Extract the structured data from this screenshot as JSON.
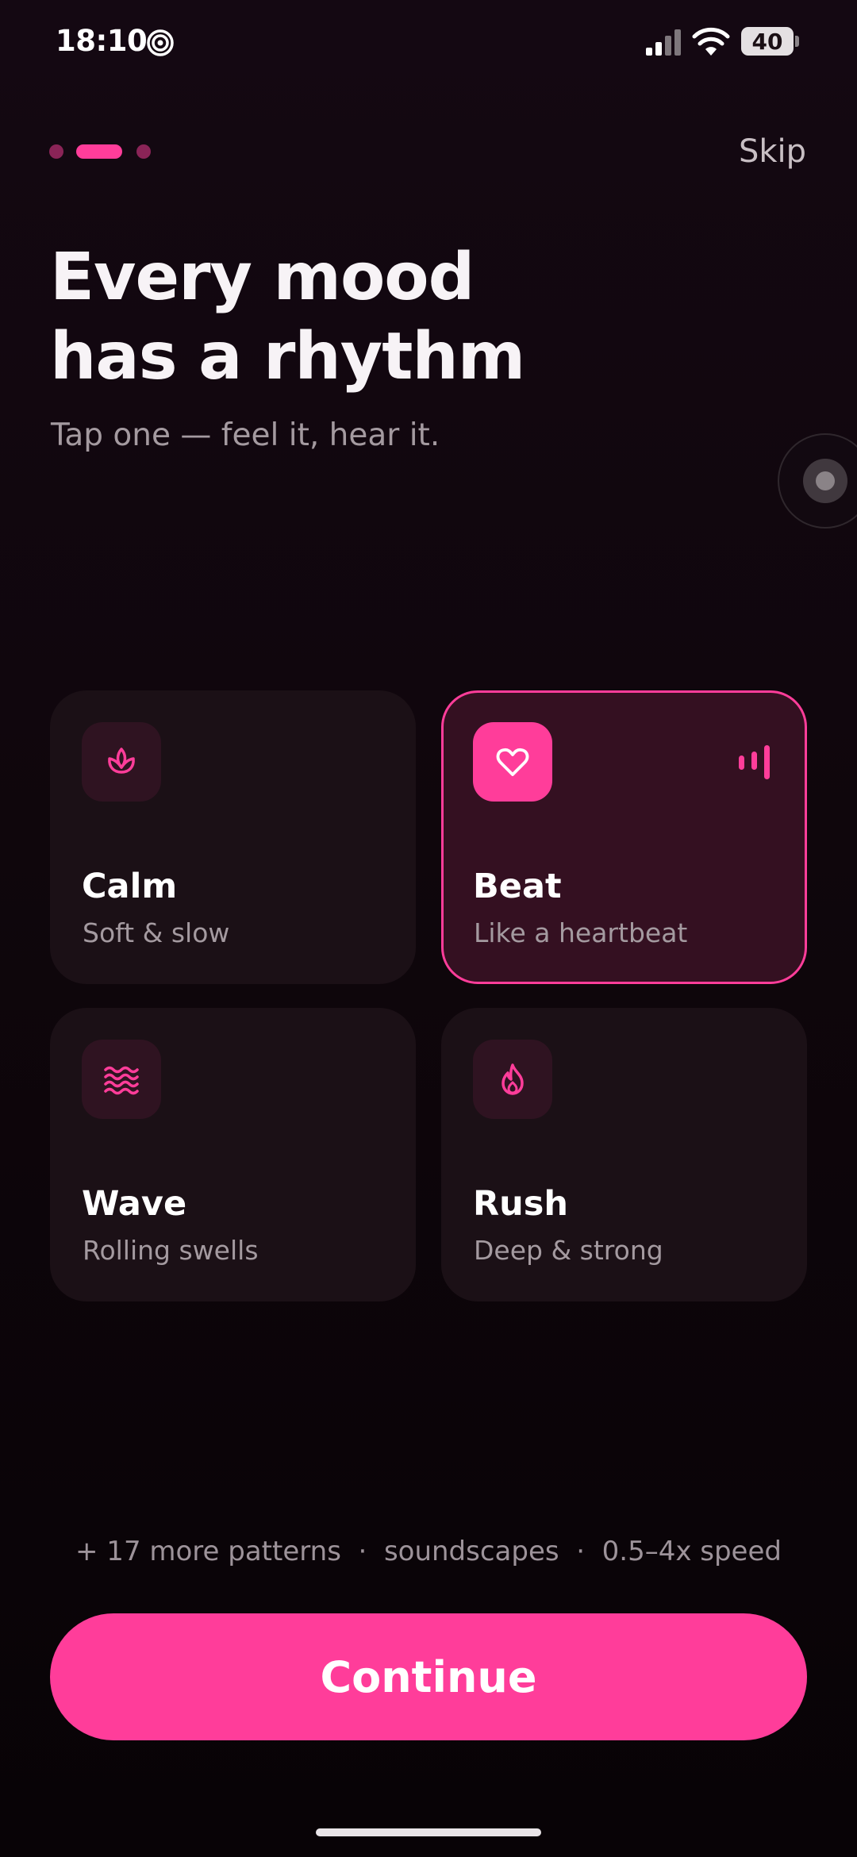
{
  "status_bar": {
    "time": "18:10",
    "battery": "40",
    "icons": [
      "spiral-icon",
      "signal-icon",
      "wifi-icon",
      "battery-icon"
    ]
  },
  "onboarding": {
    "steps_total": 3,
    "current_step": 2,
    "skip_label": "Skip"
  },
  "headline": {
    "line1": "Every mood",
    "line2": "has a rhythm",
    "subtitle": "Tap one — feel it, hear it."
  },
  "moods": [
    {
      "title": "Calm",
      "desc": "Soft & slow",
      "icon": "lotus-icon",
      "selected": false
    },
    {
      "title": "Beat",
      "desc": "Like a heartbeat",
      "icon": "heart-icon",
      "selected": true
    },
    {
      "title": "Wave",
      "desc": "Rolling swells",
      "icon": "waves-icon",
      "selected": false
    },
    {
      "title": "Rush",
      "desc": "Deep & strong",
      "icon": "flame-icon",
      "selected": false
    }
  ],
  "features_line": "+ 17 more patterns  ·  soundscapes  ·  0.5–4x speed",
  "continue_label": "Continue",
  "colors": {
    "accent": "#ff3d9a",
    "background": "#0f060c",
    "card": "#1b1016",
    "card_selected": "#341021"
  }
}
